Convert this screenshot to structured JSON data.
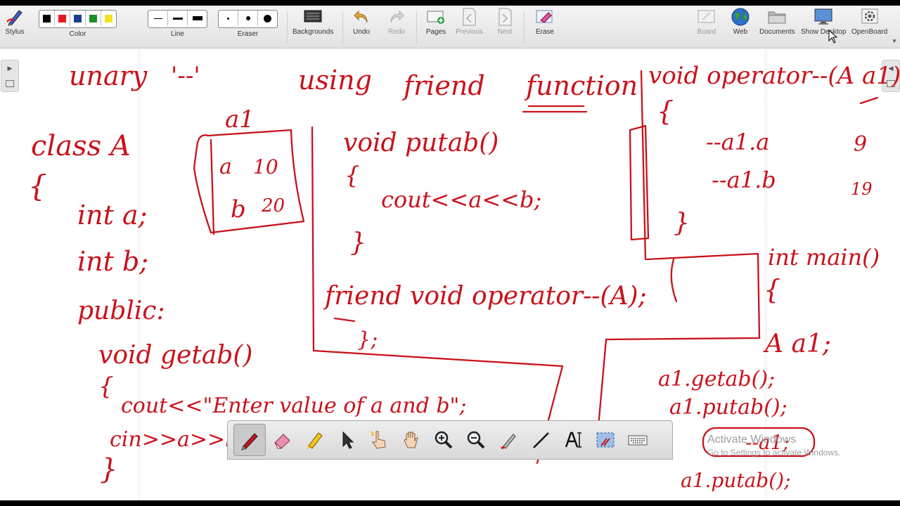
{
  "toolbar": {
    "stylus": "Stylus",
    "color": "Color",
    "line": "Line",
    "eraser": "Eraser",
    "backgrounds": "Backgrounds",
    "undo": "Undo",
    "redo": "Redo",
    "pages": "Pages",
    "previous": "Previous",
    "next": "Next",
    "erase": "Erase",
    "board": "Board",
    "web": "Web",
    "documents": "Documents",
    "show_desktop": "Show Desktop",
    "openboard": "OpenBoard",
    "colors": [
      "#000000",
      "#e8181e",
      "#1b3f8e",
      "#1d8e28",
      "#f2e21a"
    ]
  },
  "board": {
    "ink_color": "#c9121b",
    "ink": {
      "title_words": [
        "unary",
        "'--'",
        "using",
        "friend",
        "function"
      ],
      "class_lines": [
        "class A",
        "{",
        "int a;",
        "int b;",
        "public:",
        "void getab()",
        "{",
        "cout<<\"Enter value of a and b\";",
        "cin>>a>>b;",
        "10",
        "20",
        "}"
      ],
      "object_box": {
        "label": "a1",
        "a_field": "a",
        "a_value": "10",
        "b_field": "b",
        "b_value": "20"
      },
      "putab_lines": [
        "void putab()",
        "{",
        "cout<<a<<b;",
        "}"
      ],
      "friend_decl": [
        "friend void operator--(A);",
        "};"
      ],
      "operator_def": [
        "void operator--(A a1)",
        "{",
        "--a1.a",
        "9",
        "--a1.b",
        "19",
        "}"
      ],
      "main_lines": [
        "int main()",
        "{",
        "A a1;",
        "a1.getab();",
        "a1.putab();",
        "--a1;",
        "a1.putab();"
      ]
    }
  },
  "watermark": {
    "title": "Activate Windows",
    "subtitle": "Go to Settings to activate Windows."
  },
  "palette": {
    "tools": [
      "pen-tool",
      "eraser-tool",
      "highlighter-tool",
      "selector-tool",
      "interact-tool",
      "hand-tool",
      "zoom-in-tool",
      "zoom-out-tool",
      "laser-pointer-tool",
      "line-tool",
      "text-tool",
      "capture-tool",
      "keyboard-tool"
    ]
  }
}
